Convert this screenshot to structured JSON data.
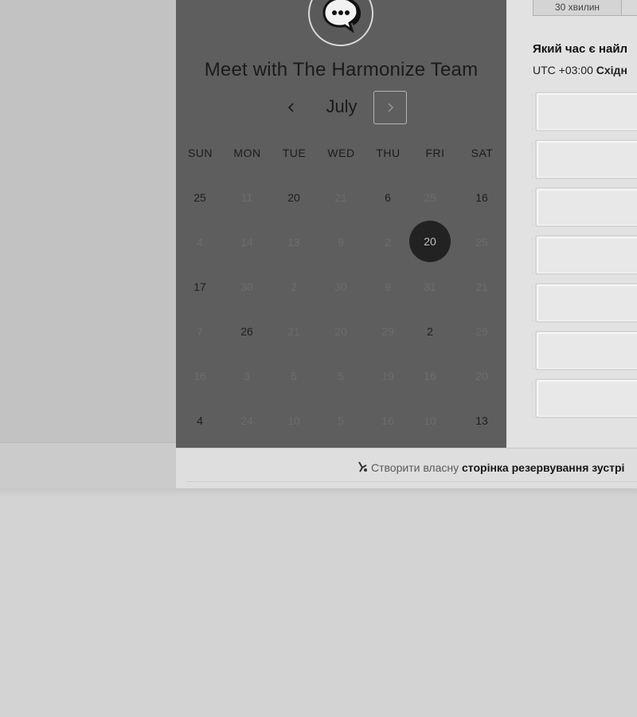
{
  "header": {
    "title": "Meet with The Harmonize Team"
  },
  "logo": {
    "icon": "chat-bubble-ellipsis-icon"
  },
  "calendar": {
    "month": "July",
    "prev_icon": "chevron-left-icon",
    "next_icon": "chevron-right-icon",
    "weekdays": [
      "SUN",
      "MON",
      "TUE",
      "WED",
      "THU",
      "FRI",
      "SAT"
    ],
    "weeks": [
      [
        {
          "d": "25",
          "a": true
        },
        {
          "d": "11",
          "a": false
        },
        {
          "d": "20",
          "a": true
        },
        {
          "d": "21",
          "a": false
        },
        {
          "d": "6",
          "a": true
        },
        {
          "d": "25",
          "a": false
        },
        {
          "d": "16",
          "a": true
        }
      ],
      [
        {
          "d": "4",
          "a": false
        },
        {
          "d": "14",
          "a": false
        },
        {
          "d": "13",
          "a": false
        },
        {
          "d": "9",
          "a": false
        },
        {
          "d": "2",
          "a": false
        },
        {
          "d": "20",
          "a": true,
          "s": true
        },
        {
          "d": "25",
          "a": false
        }
      ],
      [
        {
          "d": "17",
          "a": true
        },
        {
          "d": "30",
          "a": false
        },
        {
          "d": "2",
          "a": false
        },
        {
          "d": "30",
          "a": false
        },
        {
          "d": "9",
          "a": false
        },
        {
          "d": "31",
          "a": false
        },
        {
          "d": "21",
          "a": false
        }
      ],
      [
        {
          "d": "7",
          "a": false
        },
        {
          "d": "26",
          "a": true
        },
        {
          "d": "21",
          "a": false
        },
        {
          "d": "20",
          "a": false
        },
        {
          "d": "29",
          "a": false
        },
        {
          "d": "2",
          "a": true
        },
        {
          "d": "29",
          "a": false
        }
      ],
      [
        {
          "d": "16",
          "a": false
        },
        {
          "d": "3",
          "a": false
        },
        {
          "d": "5",
          "a": false
        },
        {
          "d": "5",
          "a": false
        },
        {
          "d": "19",
          "a": false
        },
        {
          "d": "16",
          "a": false
        },
        {
          "d": "20",
          "a": false
        }
      ],
      [
        {
          "d": "4",
          "a": true
        },
        {
          "d": "24",
          "a": false
        },
        {
          "d": "10",
          "a": false
        },
        {
          "d": "5",
          "a": false
        },
        {
          "d": "16",
          "a": false
        },
        {
          "d": "10",
          "a": false
        },
        {
          "d": "13",
          "a": true
        }
      ]
    ]
  },
  "times": {
    "duration_label": "30 хвилин",
    "question": "Який час є найл",
    "timezone_offset": "UTC +03:00",
    "timezone_name": "Східн",
    "slot_count": 7
  },
  "footer": {
    "link_prefix": "Створити власну",
    "link_bold": "сторінка резервування зустрі",
    "icon": "brand-logo-icon"
  }
}
